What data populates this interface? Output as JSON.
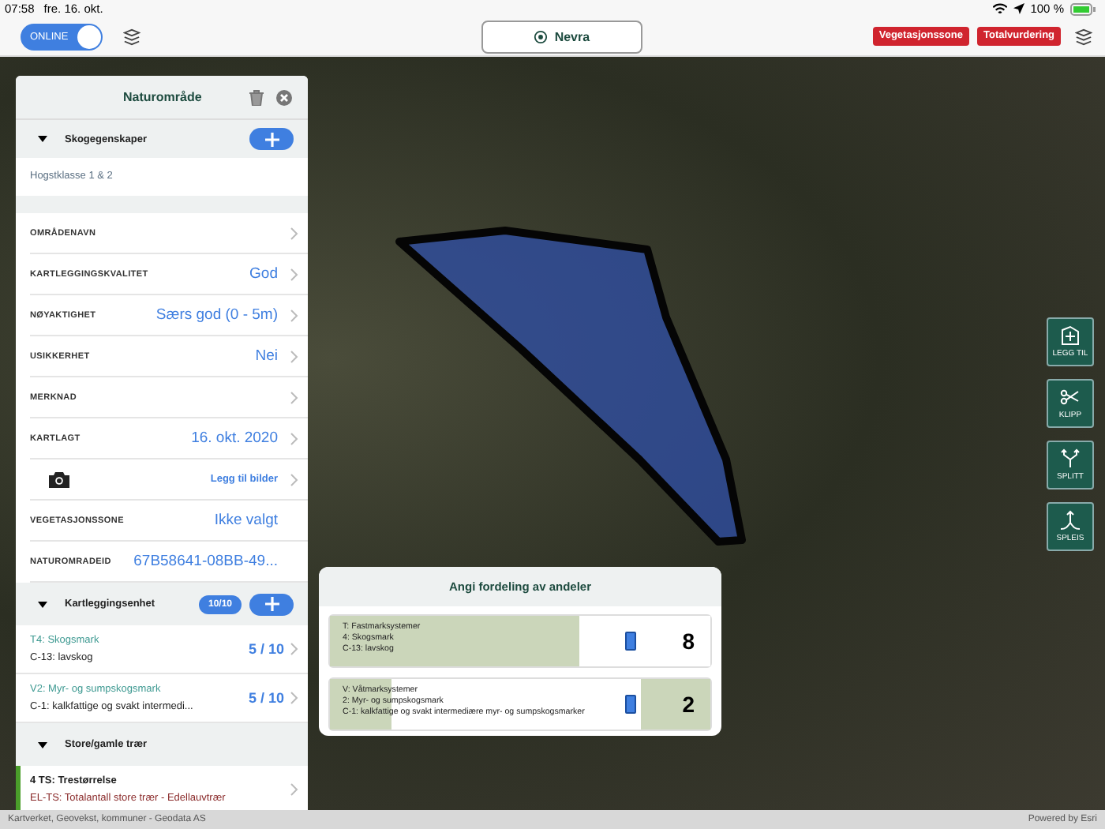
{
  "status_bar": {
    "time": "07:58",
    "date": "fre. 16. okt.",
    "battery": "100 %"
  },
  "toolbar": {
    "online_toggle": {
      "label": "ONLINE",
      "on": true
    },
    "location": "Nevra",
    "buttons": [
      "Vegetasjonssone",
      "Totalvurdering"
    ]
  },
  "panel": {
    "title": "Naturområde",
    "forest": {
      "title": "Skogegenskaper",
      "expanded": true,
      "items": [
        "Hogstklasse 1 & 2"
      ]
    },
    "fields": [
      {
        "kind": "link",
        "label": "OMRÅDENAVN"
      },
      {
        "kind": "link",
        "label": "KARTLEGGINGSKVALITET",
        "value": "God"
      },
      {
        "kind": "link",
        "label": "NØYAKTIGHET",
        "value": "Særs god (0 - 5m)"
      },
      {
        "kind": "link",
        "label": "USIKKERHET",
        "value": "Nei"
      },
      {
        "kind": "link",
        "label": "MERKNAD"
      },
      {
        "kind": "link",
        "label": "KARTLAGT",
        "value": "16. okt. 2020"
      },
      {
        "kind": "photo",
        "value": "Legg til bilder"
      },
      {
        "kind": "static",
        "label": "VEGETASJONSSONE",
        "value": "Ikke valgt"
      },
      {
        "kind": "static",
        "label": "NATUROMRADEID",
        "value": "67B58641-08BB-49..."
      }
    ],
    "units": {
      "title": "Kartleggingsenhet",
      "count": "10/10",
      "expanded": true,
      "items": [
        {
          "code": "T4: Skogsmark",
          "sub": "C-13: lavskog",
          "share": "5 / 10"
        },
        {
          "code": "V2: Myr- og sumpskogsmark",
          "sub": "C-1: kalkfattige og svakt intermedi...",
          "share": "5 / 10"
        }
      ]
    },
    "trees": {
      "title": "Store/gamle trær",
      "expanded": true,
      "items": [
        {
          "title": "4 TS: Trestørrelse",
          "sub": "EL-TS: Totalantall store trær - Edellauvtrær"
        }
      ]
    }
  },
  "popup": {
    "title": "Angi fordeling av andeler",
    "rows": [
      {
        "lines": [
          "T: Fastmarksystemer",
          "4: Skogsmark",
          "C-13: lavskog"
        ],
        "value": "8",
        "level": 0.8
      },
      {
        "lines": [
          "V: Våtmarksystemer",
          "2: Myr- og sumpskogsmark",
          "C-1: kalkfattige og svakt intermediære myr- og sumpskogsmarker"
        ],
        "value": "2",
        "level": 0.2
      }
    ]
  },
  "tools": [
    {
      "kind": "add",
      "label": "LEGG TIL"
    },
    {
      "kind": "cut",
      "label": "KLIPP"
    },
    {
      "kind": "split",
      "label": "SPLITT"
    },
    {
      "kind": "join",
      "label": "SPLEIS"
    }
  ],
  "attribution": {
    "credits": "Kartverket, Geovekst, kommuner - Geodata AS",
    "powered": "Powered by Esri"
  }
}
